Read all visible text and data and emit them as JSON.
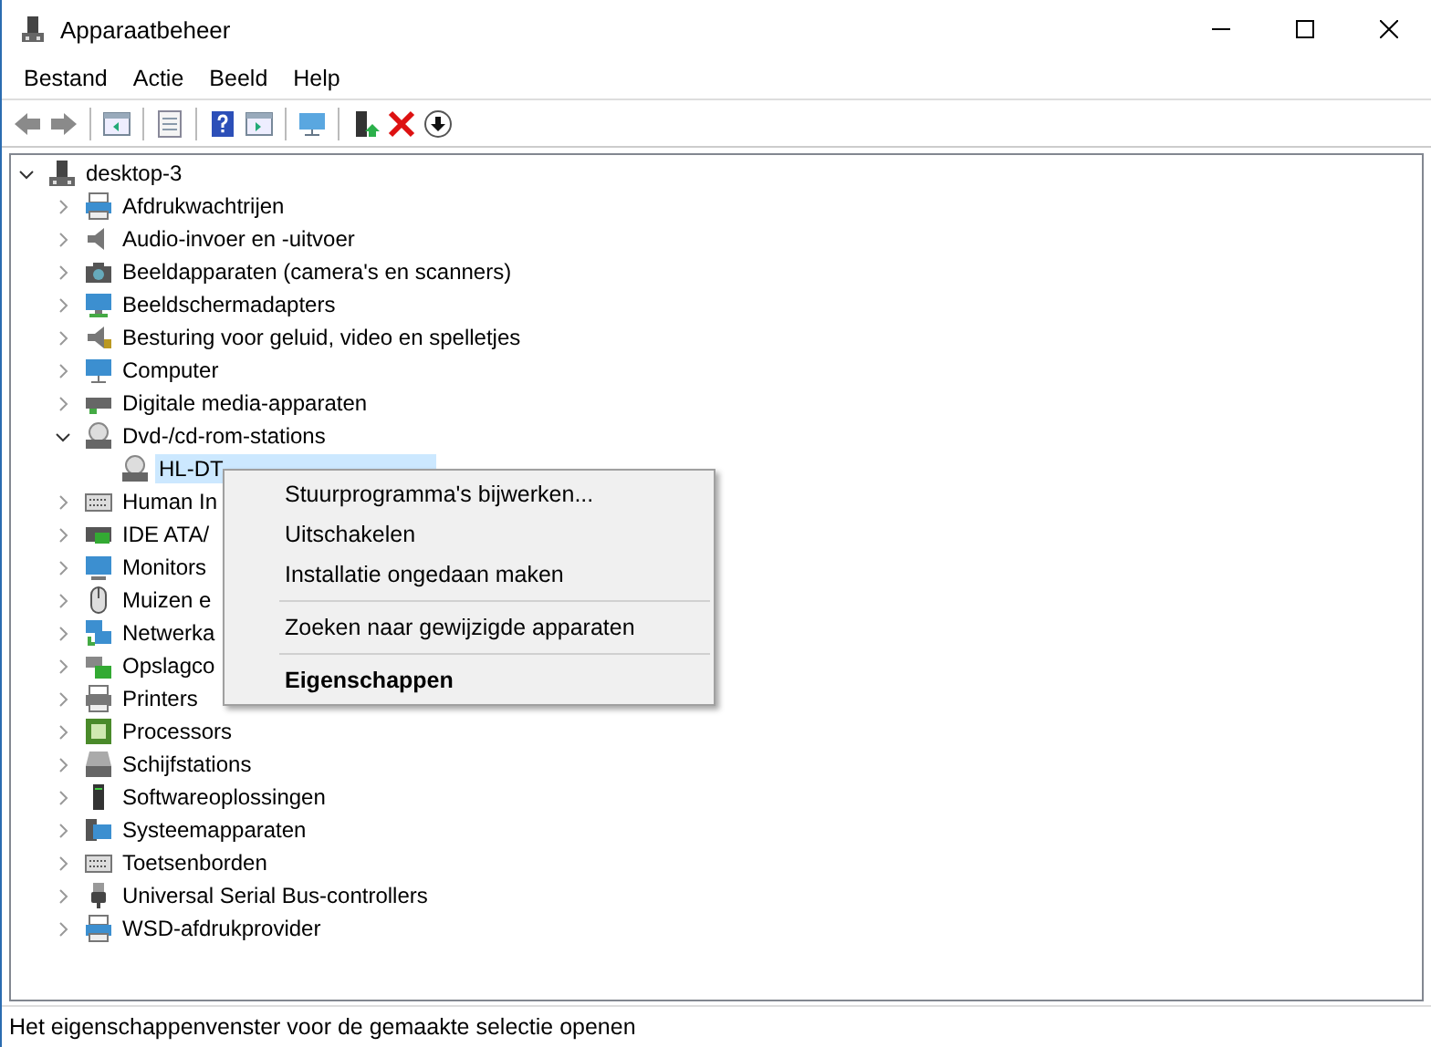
{
  "window": {
    "title": "Apparaatbeheer"
  },
  "menu_bar": [
    "Bestand",
    "Actie",
    "Beeld",
    "Help"
  ],
  "tree": {
    "label": "desktop-3",
    "expanded": true,
    "selected": false,
    "children": [
      {
        "label": "Afdrukwachtrijen",
        "expanded": false,
        "selected": false
      },
      {
        "label": "Audio-invoer en -uitvoer",
        "expanded": false,
        "selected": false
      },
      {
        "label": "Beeldapparaten (camera's en scanners)",
        "expanded": false,
        "selected": false
      },
      {
        "label": "Beeldschermadapters",
        "expanded": false,
        "selected": false
      },
      {
        "label": "Besturing voor geluid, video en spelletjes",
        "expanded": false,
        "selected": false
      },
      {
        "label": "Computer",
        "expanded": false,
        "selected": false
      },
      {
        "label": "Digitale media-apparaten",
        "expanded": false,
        "selected": false
      },
      {
        "label": "Dvd-/cd-rom-stations",
        "expanded": true,
        "selected": false,
        "children": [
          {
            "label": "HL-DT",
            "selected": true
          }
        ]
      },
      {
        "label": "Human In",
        "expanded": false,
        "selected": false
      },
      {
        "label": "IDE ATA/",
        "expanded": false,
        "selected": false
      },
      {
        "label": "Monitors",
        "expanded": false,
        "selected": false
      },
      {
        "label": "Muizen e",
        "expanded": false,
        "selected": false
      },
      {
        "label": "Netwerka",
        "expanded": false,
        "selected": false
      },
      {
        "label": "Opslagco",
        "expanded": false,
        "selected": false
      },
      {
        "label": "Printers",
        "expanded": false,
        "selected": false
      },
      {
        "label": "Processors",
        "expanded": false,
        "selected": false
      },
      {
        "label": "Schijfstations",
        "expanded": false,
        "selected": false
      },
      {
        "label": "Softwareoplossingen",
        "expanded": false,
        "selected": false
      },
      {
        "label": "Systeemapparaten",
        "expanded": false,
        "selected": false
      },
      {
        "label": "Toetsenborden",
        "expanded": false,
        "selected": false
      },
      {
        "label": "Universal Serial Bus-controllers",
        "expanded": false,
        "selected": false
      },
      {
        "label": "WSD-afdrukprovider",
        "expanded": false,
        "selected": false
      }
    ]
  },
  "context_menu": [
    {
      "kind": "item",
      "label": "Stuurprogramma's bijwerken...",
      "default": false
    },
    {
      "kind": "item",
      "label": "Uitschakelen",
      "default": false
    },
    {
      "kind": "item",
      "label": "Installatie ongedaan maken",
      "default": false
    },
    {
      "kind": "separator"
    },
    {
      "kind": "item",
      "label": "Zoeken naar gewijzigde apparaten",
      "default": false
    },
    {
      "kind": "separator"
    },
    {
      "kind": "item",
      "label": "Eigenschappen",
      "default": true
    }
  ],
  "status_bar": "Het eigenschappenvenster voor de gemaakte selectie openen"
}
